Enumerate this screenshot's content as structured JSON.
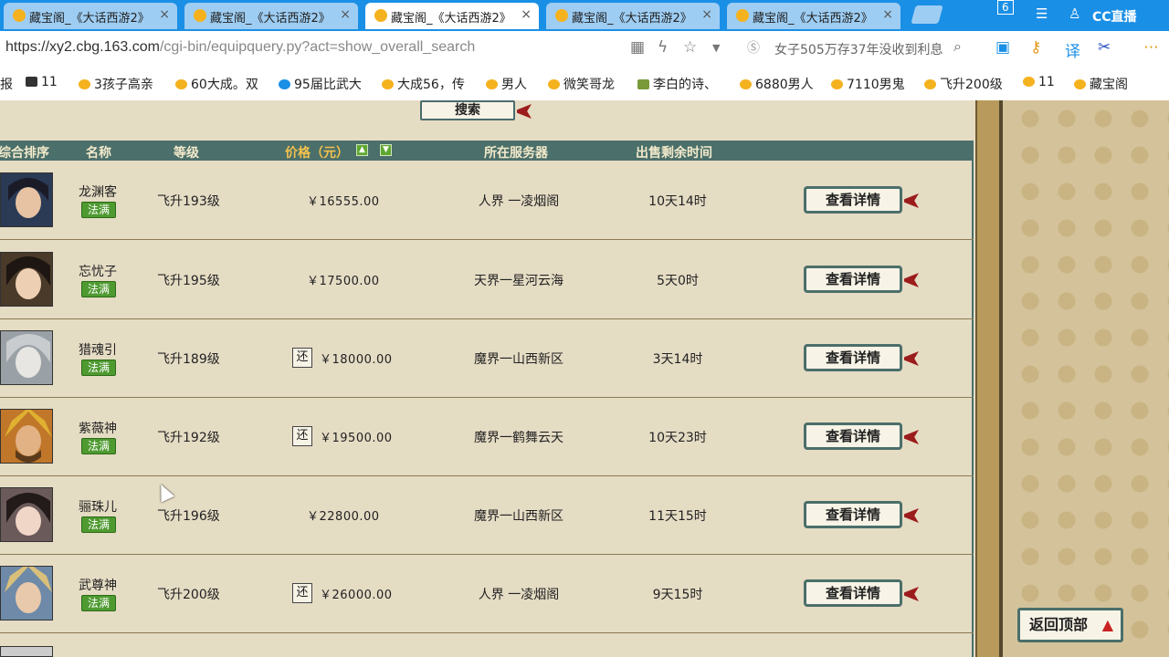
{
  "browser": {
    "tabs": [
      {
        "title": "藏宝阁_《大话西游2》",
        "active": false
      },
      {
        "title": "藏宝阁_《大话西游2》",
        "active": false
      },
      {
        "title": "藏宝阁_《大话西游2》",
        "active": true
      },
      {
        "title": "藏宝阁_《大话西游2》",
        "active": false
      },
      {
        "title": "藏宝阁_《大话西游2》",
        "active": false
      }
    ],
    "tab_close": "×",
    "toolbar_badge": "6",
    "cc_logo": "CC直播",
    "address": {
      "host": "https://xy2.cbg.163.com",
      "path": "/cgi-bin/equipquery.py?act=show_overall_search"
    },
    "search_text": "女子505万存37年没收到利息",
    "bookmarks": [
      "报",
      "11",
      "3孩子高亲",
      "60大成。双",
      "95届比武大",
      "大成56，传",
      "男人",
      "微笑哥龙",
      "李白的诗、",
      "6880男人",
      "7110男鬼",
      "飞升200级",
      "11",
      "藏宝阁"
    ]
  },
  "page": {
    "search_button": "搜索",
    "table_headers": {
      "rank": "综合排序",
      "name": "名称",
      "level": "等级",
      "price": "价格（元）",
      "server": "所在服务器",
      "time_left": "出售剩余时间"
    },
    "sort_up": "▲",
    "sort_down": "▼",
    "badge_label": "法满",
    "huan_label": "还",
    "detail_label": "查看详情",
    "rows": [
      {
        "name": "龙渊客",
        "level": "飞升193级",
        "price": "￥16555.00",
        "huan": false,
        "server": "人界 一凌烟阁",
        "time": "10天14时"
      },
      {
        "name": "忘忧子",
        "level": "飞升195级",
        "price": "￥17500.00",
        "huan": false,
        "server": "天界一星河云海",
        "time": "5天0时"
      },
      {
        "name": "猎魂引",
        "level": "飞升189级",
        "price": "￥18000.00",
        "huan": true,
        "server": "魔界一山西新区",
        "time": "3天14时"
      },
      {
        "name": "紫薇神",
        "level": "飞升192级",
        "price": "￥19500.00",
        "huan": true,
        "server": "魔界一鹤舞云天",
        "time": "10天23时"
      },
      {
        "name": "骊珠儿",
        "level": "飞升196级",
        "price": "￥22800.00",
        "huan": false,
        "server": "魔界一山西新区",
        "time": "11天15时"
      },
      {
        "name": "武尊神",
        "level": "飞升200级",
        "price": "￥26000.00",
        "huan": true,
        "server": "人界 一凌烟阁",
        "time": "9天15时"
      }
    ],
    "back_to_top": "返回顶部"
  }
}
